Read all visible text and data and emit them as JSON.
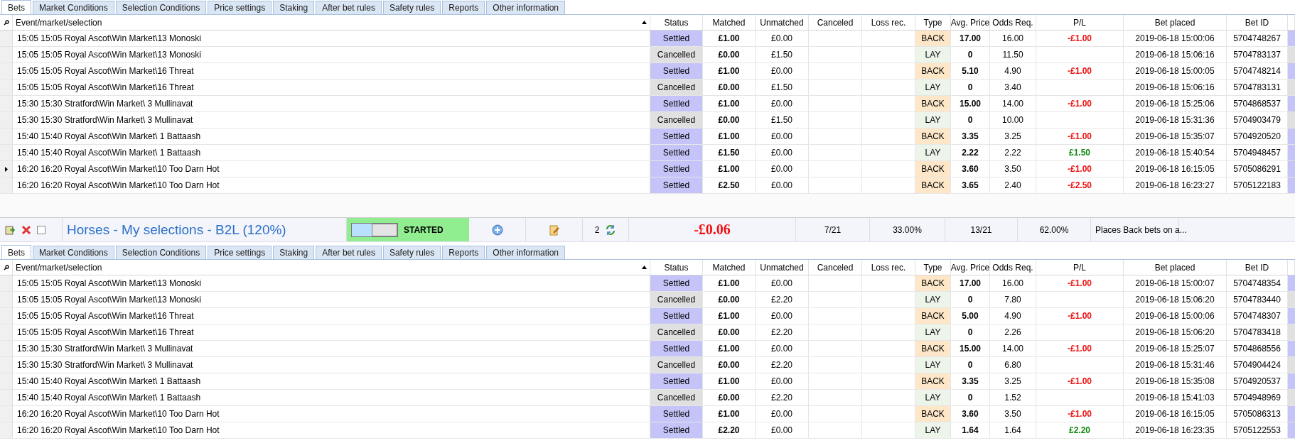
{
  "panels": [
    {
      "tabs": [
        {
          "label": "Bets",
          "selected": true
        },
        {
          "label": "Market Conditions",
          "selected": false
        },
        {
          "label": "Selection Conditions",
          "selected": false
        },
        {
          "label": "Price settings",
          "selected": false
        },
        {
          "label": "Staking",
          "selected": false
        },
        {
          "label": "After bet rules",
          "selected": false
        },
        {
          "label": "Safety rules",
          "selected": false
        },
        {
          "label": "Reports",
          "selected": false
        },
        {
          "label": "Other information",
          "selected": false
        }
      ],
      "columns": [
        "Event/market/selection",
        "Status",
        "Matched",
        "Unmatched",
        "Canceled",
        "Loss rec.",
        "Type",
        "Avg. Price",
        "Odds Req.",
        "P/L",
        "Bet placed",
        "Bet ID"
      ],
      "rows": [
        {
          "current": false,
          "event": "15:05 15:05 Royal Ascot\\Win Market\\13 Monoski",
          "status": {
            "label": "Settled",
            "kind": "settled"
          },
          "matched": "£1.00",
          "unmatched": "£0.00",
          "type": {
            "label": "BACK",
            "kind": "back"
          },
          "avg_price": "17.00",
          "odds_req": "16.00",
          "pl": {
            "label": "-£1.00",
            "kind": "loss"
          },
          "bet_placed": "2019-06-18 15:00:06",
          "bet_id": "5704748267"
        },
        {
          "current": false,
          "event": "15:05 15:05 Royal Ascot\\Win Market\\13 Monoski",
          "status": {
            "label": "Cancelled",
            "kind": "cancelled"
          },
          "matched": "£0.00",
          "unmatched": "£1.50",
          "type": {
            "label": "LAY",
            "kind": "lay"
          },
          "avg_price": "0",
          "odds_req": "11.50",
          "bet_placed": "2019-06-18 15:06:16",
          "bet_id": "5704783137"
        },
        {
          "current": false,
          "event": "15:05 15:05 Royal Ascot\\Win Market\\16 Threat",
          "status": {
            "label": "Settled",
            "kind": "settled"
          },
          "matched": "£1.00",
          "unmatched": "£0.00",
          "type": {
            "label": "BACK",
            "kind": "back"
          },
          "avg_price": "5.10",
          "odds_req": "4.90",
          "pl": {
            "label": "-£1.00",
            "kind": "loss"
          },
          "bet_placed": "2019-06-18 15:00:05",
          "bet_id": "5704748214"
        },
        {
          "current": false,
          "event": "15:05 15:05 Royal Ascot\\Win Market\\16 Threat",
          "status": {
            "label": "Cancelled",
            "kind": "cancelled"
          },
          "matched": "£0.00",
          "unmatched": "£1.50",
          "type": {
            "label": "LAY",
            "kind": "lay"
          },
          "avg_price": "0",
          "odds_req": "3.40",
          "bet_placed": "2019-06-18 15:06:16",
          "bet_id": "5704783131"
        },
        {
          "current": false,
          "event": "15:30 15:30 Stratford\\Win Market\\ 3 Mullinavat",
          "status": {
            "label": "Settled",
            "kind": "settled"
          },
          "matched": "£1.00",
          "unmatched": "£0.00",
          "type": {
            "label": "BACK",
            "kind": "back"
          },
          "avg_price": "15.00",
          "odds_req": "14.00",
          "pl": {
            "label": "-£1.00",
            "kind": "loss"
          },
          "bet_placed": "2019-06-18 15:25:06",
          "bet_id": "5704868537"
        },
        {
          "current": false,
          "event": "15:30 15:30 Stratford\\Win Market\\ 3 Mullinavat",
          "status": {
            "label": "Cancelled",
            "kind": "cancelled"
          },
          "matched": "£0.00",
          "unmatched": "£1.50",
          "type": {
            "label": "LAY",
            "kind": "lay"
          },
          "avg_price": "0",
          "odds_req": "10.00",
          "bet_placed": "2019-06-18 15:31:36",
          "bet_id": "5704903479"
        },
        {
          "current": false,
          "event": "15:40 15:40 Royal Ascot\\Win Market\\ 1 Battaash",
          "status": {
            "label": "Settled",
            "kind": "settled"
          },
          "matched": "£1.00",
          "unmatched": "£0.00",
          "type": {
            "label": "BACK",
            "kind": "back"
          },
          "avg_price": "3.35",
          "odds_req": "3.25",
          "pl": {
            "label": "-£1.00",
            "kind": "loss"
          },
          "bet_placed": "2019-06-18 15:35:07",
          "bet_id": "5704920520"
        },
        {
          "current": false,
          "event": "15:40 15:40 Royal Ascot\\Win Market\\ 1 Battaash",
          "status": {
            "label": "Settled",
            "kind": "settled"
          },
          "matched": "£1.50",
          "unmatched": "£0.00",
          "type": {
            "label": "LAY",
            "kind": "lay"
          },
          "avg_price": "2.22",
          "odds_req": "2.22",
          "pl": {
            "label": "£1.50",
            "kind": "profit"
          },
          "bet_placed": "2019-06-18 15:40:54",
          "bet_id": "5704948457"
        },
        {
          "current": true,
          "event": "16:20 16:20 Royal Ascot\\Win Market\\10 Too Darn Hot",
          "status": {
            "label": "Settled",
            "kind": "settled"
          },
          "matched": "£1.00",
          "unmatched": "£0.00",
          "type": {
            "label": "BACK",
            "kind": "back"
          },
          "avg_price": "3.60",
          "odds_req": "3.50",
          "pl": {
            "label": "-£1.00",
            "kind": "loss"
          },
          "bet_placed": "2019-06-18 16:15:05",
          "bet_id": "5705086291"
        },
        {
          "current": false,
          "event": "16:20 16:20 Royal Ascot\\Win Market\\10 Too Darn Hot",
          "status": {
            "label": "Settled",
            "kind": "settled"
          },
          "matched": "£2.50",
          "unmatched": "£0.00",
          "type": {
            "label": "BACK",
            "kind": "back"
          },
          "avg_price": "3.65",
          "odds_req": "2.40",
          "pl": {
            "label": "-£2.50",
            "kind": "loss"
          },
          "bet_placed": "2019-06-18 16:23:27",
          "bet_id": "5705122183"
        }
      ]
    },
    {
      "tabs": [
        {
          "label": "Bets",
          "selected": true
        },
        {
          "label": "Market Conditions",
          "selected": false
        },
        {
          "label": "Selection Conditions",
          "selected": false
        },
        {
          "label": "Price settings",
          "selected": false
        },
        {
          "label": "Staking",
          "selected": false
        },
        {
          "label": "After bet rules",
          "selected": false
        },
        {
          "label": "Safety rules",
          "selected": false
        },
        {
          "label": "Reports",
          "selected": false
        },
        {
          "label": "Other information",
          "selected": false
        }
      ],
      "columns": [
        "Event/market/selection",
        "Status",
        "Matched",
        "Unmatched",
        "Canceled",
        "Loss rec.",
        "Type",
        "Avg. Price",
        "Odds Req.",
        "P/L",
        "Bet placed",
        "Bet ID"
      ],
      "rows": [
        {
          "current": false,
          "event": "15:05 15:05 Royal Ascot\\Win Market\\13 Monoski",
          "status": {
            "label": "Settled",
            "kind": "settled"
          },
          "matched": "£1.00",
          "unmatched": "£0.00",
          "type": {
            "label": "BACK",
            "kind": "back"
          },
          "avg_price": "17.00",
          "odds_req": "16.00",
          "pl": {
            "label": "-£1.00",
            "kind": "loss"
          },
          "bet_placed": "2019-06-18 15:00:07",
          "bet_id": "5704748354"
        },
        {
          "current": false,
          "event": "15:05 15:05 Royal Ascot\\Win Market\\13 Monoski",
          "status": {
            "label": "Cancelled",
            "kind": "cancelled"
          },
          "matched": "£0.00",
          "unmatched": "£2.20",
          "type": {
            "label": "LAY",
            "kind": "lay"
          },
          "avg_price": "0",
          "odds_req": "7.80",
          "bet_placed": "2019-06-18 15:06:20",
          "bet_id": "5704783440"
        },
        {
          "current": false,
          "event": "15:05 15:05 Royal Ascot\\Win Market\\16 Threat",
          "status": {
            "label": "Settled",
            "kind": "settled"
          },
          "matched": "£1.00",
          "unmatched": "£0.00",
          "type": {
            "label": "BACK",
            "kind": "back"
          },
          "avg_price": "5.00",
          "odds_req": "4.90",
          "pl": {
            "label": "-£1.00",
            "kind": "loss"
          },
          "bet_placed": "2019-06-18 15:00:06",
          "bet_id": "5704748307"
        },
        {
          "current": false,
          "event": "15:05 15:05 Royal Ascot\\Win Market\\16 Threat",
          "status": {
            "label": "Cancelled",
            "kind": "cancelled"
          },
          "matched": "£0.00",
          "unmatched": "£2.20",
          "type": {
            "label": "LAY",
            "kind": "lay"
          },
          "avg_price": "0",
          "odds_req": "2.26",
          "bet_placed": "2019-06-18 15:06:20",
          "bet_id": "5704783418"
        },
        {
          "current": false,
          "event": "15:30 15:30 Stratford\\Win Market\\ 3 Mullinavat",
          "status": {
            "label": "Settled",
            "kind": "settled"
          },
          "matched": "£1.00",
          "unmatched": "£0.00",
          "type": {
            "label": "BACK",
            "kind": "back"
          },
          "avg_price": "15.00",
          "odds_req": "14.00",
          "pl": {
            "label": "-£1.00",
            "kind": "loss"
          },
          "bet_placed": "2019-06-18 15:25:07",
          "bet_id": "5704868556"
        },
        {
          "current": false,
          "event": "15:30 15:30 Stratford\\Win Market\\ 3 Mullinavat",
          "status": {
            "label": "Cancelled",
            "kind": "cancelled"
          },
          "matched": "£0.00",
          "unmatched": "£2.20",
          "type": {
            "label": "LAY",
            "kind": "lay"
          },
          "avg_price": "0",
          "odds_req": "6.80",
          "bet_placed": "2019-06-18 15:31:46",
          "bet_id": "5704904424"
        },
        {
          "current": false,
          "event": "15:40 15:40 Royal Ascot\\Win Market\\ 1 Battaash",
          "status": {
            "label": "Settled",
            "kind": "settled"
          },
          "matched": "£1.00",
          "unmatched": "£0.00",
          "type": {
            "label": "BACK",
            "kind": "back"
          },
          "avg_price": "3.35",
          "odds_req": "3.25",
          "pl": {
            "label": "-£1.00",
            "kind": "loss"
          },
          "bet_placed": "2019-06-18 15:35:08",
          "bet_id": "5704920537"
        },
        {
          "current": false,
          "event": "15:40 15:40 Royal Ascot\\Win Market\\ 1 Battaash",
          "status": {
            "label": "Cancelled",
            "kind": "cancelled"
          },
          "matched": "£0.00",
          "unmatched": "£2.20",
          "type": {
            "label": "LAY",
            "kind": "lay"
          },
          "avg_price": "0",
          "odds_req": "1.52",
          "bet_placed": "2019-06-18 15:41:03",
          "bet_id": "5704948969"
        },
        {
          "current": false,
          "event": "16:20 16:20 Royal Ascot\\Win Market\\10 Too Darn Hot",
          "status": {
            "label": "Settled",
            "kind": "settled"
          },
          "matched": "£1.00",
          "unmatched": "£0.00",
          "type": {
            "label": "BACK",
            "kind": "back"
          },
          "avg_price": "3.60",
          "odds_req": "3.50",
          "pl": {
            "label": "-£1.00",
            "kind": "loss"
          },
          "bet_placed": "2019-06-18 16:15:05",
          "bet_id": "5705086313"
        },
        {
          "current": false,
          "event": "16:20 16:20 Royal Ascot\\Win Market\\10 Too Darn Hot",
          "status": {
            "label": "Settled",
            "kind": "settled"
          },
          "matched": "£2.20",
          "unmatched": "£0.00",
          "type": {
            "label": "LAY",
            "kind": "lay"
          },
          "avg_price": "1.64",
          "odds_req": "1.64",
          "pl": {
            "label": "£2.20",
            "kind": "profit"
          },
          "bet_placed": "2019-06-18 16:23:35",
          "bet_id": "5705122553"
        }
      ]
    }
  ],
  "strategy": {
    "checked": false,
    "title": "Horses - My selections - B2L (120%)",
    "running": true,
    "state": "STARTED",
    "count": "2",
    "pl": {
      "label": "-£0.06",
      "kind": "loss"
    },
    "won": "7/21",
    "won_pct": "33.00%",
    "lost": "13/21",
    "lost_pct": "62.00%",
    "description": "Places Back bets on a..."
  }
}
